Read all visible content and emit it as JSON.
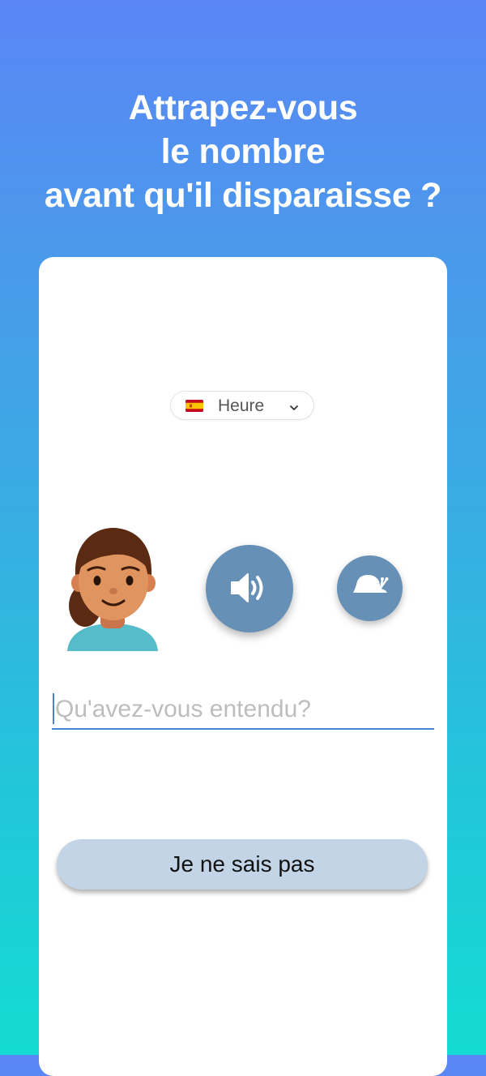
{
  "headline": {
    "line1": "Attrapez-vous",
    "line2": "le nombre",
    "line3": "avant qu'il disparaisse ?"
  },
  "language_selector": {
    "flag_icon": "spain-flag-icon",
    "selected_value": "Heure",
    "chevron_icon": "chevron-down-icon"
  },
  "avatar": {
    "icon": "woman-avatar-icon"
  },
  "controls": {
    "play_sound_icon": "speaker-icon",
    "slow_playback_icon": "snail-icon"
  },
  "answer_input": {
    "value": "",
    "placeholder": "Qu'avez-vous entendu?"
  },
  "dont_know_button": {
    "label": "Je ne sais pas"
  },
  "colors": {
    "gradient_top": "#5a86f6",
    "gradient_bottom": "#14dcd2",
    "control_blue": "#6690b6",
    "button_light_blue": "#c2d4e6",
    "input_underline": "#4a84d6"
  }
}
